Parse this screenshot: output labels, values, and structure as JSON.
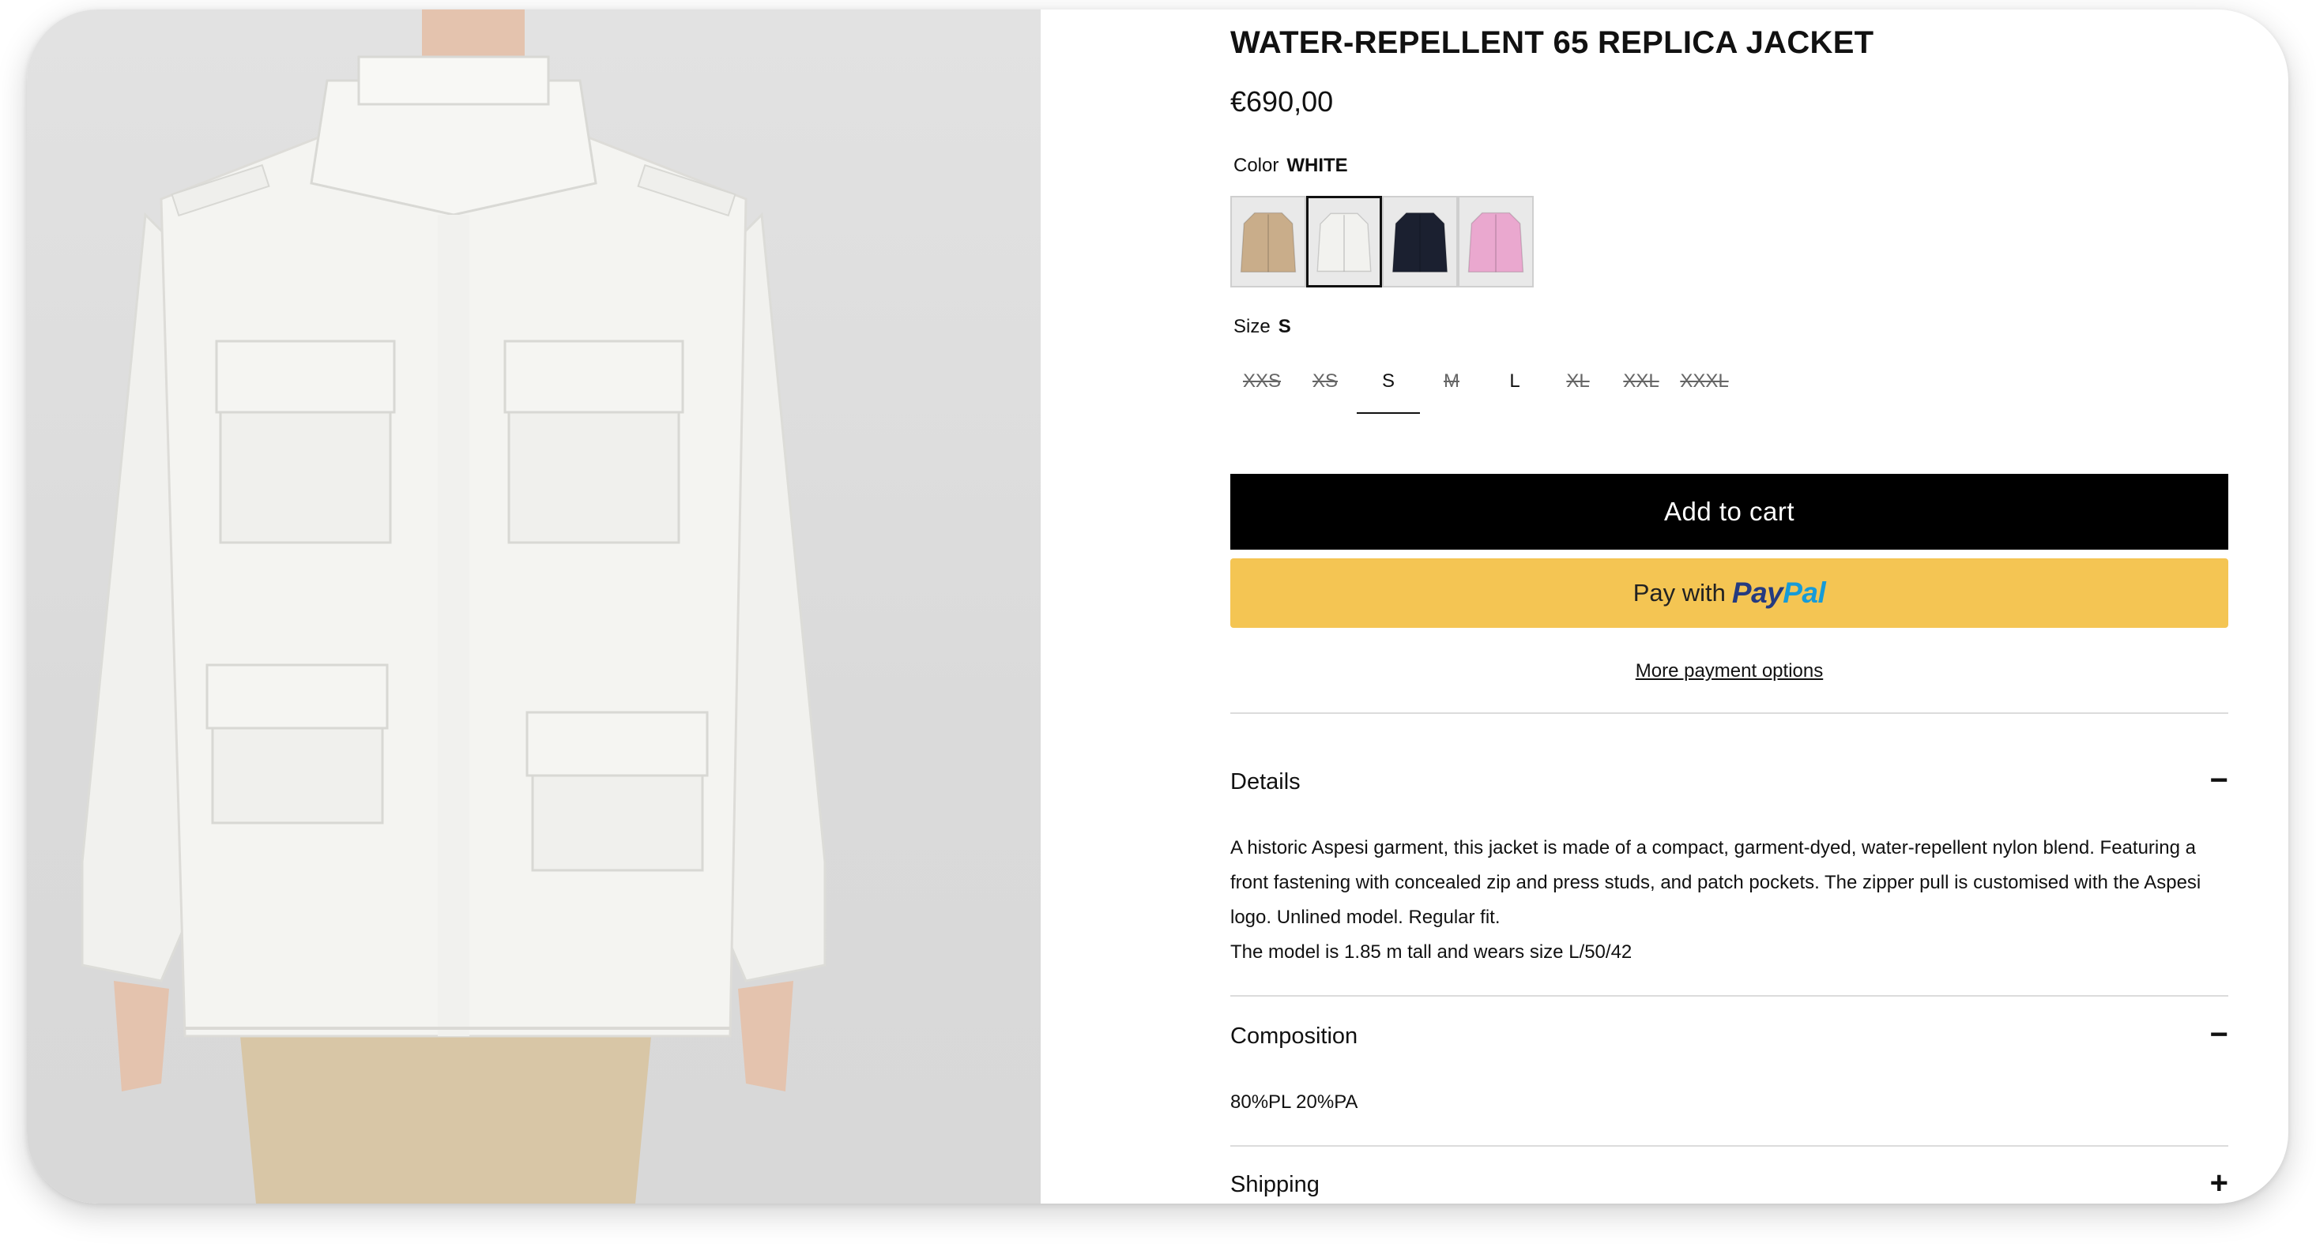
{
  "product": {
    "title": "WATER-REPELLENT 65 REPLICA JACKET",
    "price": "€690,00"
  },
  "color": {
    "label": "Color",
    "selected": "WHITE",
    "swatches": [
      {
        "name": "beige",
        "fill": "#c9ad8a"
      },
      {
        "name": "white",
        "fill": "#f2f2ef"
      },
      {
        "name": "navy",
        "fill": "#1b2030"
      },
      {
        "name": "pink",
        "fill": "#eaa8cf"
      }
    ],
    "selected_index": 1
  },
  "size": {
    "label": "Size",
    "selected": "S",
    "options": [
      {
        "label": "XXS",
        "available": false
      },
      {
        "label": "XS",
        "available": false
      },
      {
        "label": "S",
        "available": true
      },
      {
        "label": "M",
        "available": false
      },
      {
        "label": "L",
        "available": true
      },
      {
        "label": "XL",
        "available": false
      },
      {
        "label": "XXL",
        "available": false
      },
      {
        "label": "XXXL",
        "available": false
      }
    ]
  },
  "buttons": {
    "add_to_cart": "Add to cart",
    "paypal_prefix": "Pay with",
    "paypal_brand_pay": "Pay",
    "paypal_brand_pal": "Pal",
    "more_payment": "More payment options"
  },
  "accordion": {
    "details": {
      "title": "Details",
      "toggle": "−",
      "text": "A historic Aspesi garment, this jacket is made of a compact, garment-dyed, water-repellent nylon blend. Featuring a front fastening with concealed zip and press studs, and patch pockets. The zipper pull is customised with the Aspesi logo. Unlined model. Regular fit.",
      "model_note": "The model is 1.85 m tall and wears size L/50/42"
    },
    "composition": {
      "title": "Composition",
      "toggle": "−",
      "text": "80%PL 20%PA"
    },
    "shipping": {
      "title": "Shipping",
      "toggle": "+"
    }
  },
  "colors": {
    "accent_black": "#000000",
    "paypal_yellow": "#f4c553",
    "paypal_dark_blue": "#253b80",
    "paypal_light_blue": "#179bd7"
  }
}
